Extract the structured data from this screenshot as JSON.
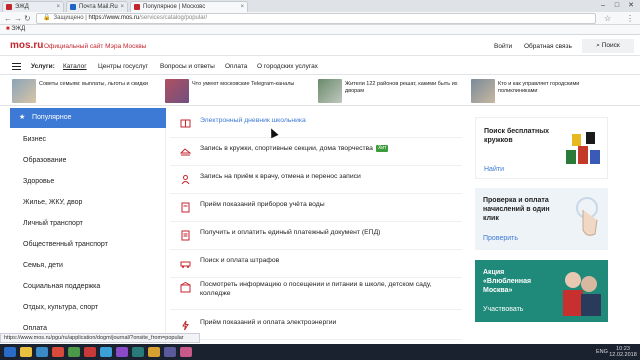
{
  "browser": {
    "tabs": [
      {
        "label": "ЭЖД"
      },
      {
        "label": "Почта Mail.Ru"
      },
      {
        "label": "Популярное | Московс"
      }
    ],
    "tab_close": "×",
    "security_label": "Защищено",
    "url_host": "https://www.mos.ru",
    "url_path": "/services/catalog/popular/",
    "bookmark": "ЭЖД",
    "status_url": "https://www.mos.ru/pgu/ru/application/dogm/journal/?onsite_from=popular"
  },
  "site": {
    "logo": "mos.ru",
    "tagline": "Официальный сайт Мэра Москвы",
    "login": "Войти",
    "feedback": "Обратная связь",
    "search": "Поиск"
  },
  "nav": {
    "label": "Услуги:",
    "items": [
      "Каталог",
      "Центры госуслуг",
      "Вопросы и ответы",
      "Оплата",
      "О городских услугах"
    ]
  },
  "news": [
    "Советы семьям: выплаты, льготы и скидки",
    "Что умеют московские Telegram-каналы",
    "Жители 122 районов решат, какими быть их дворам",
    "Кто и как управляет городскими поликлиниками"
  ],
  "menu": [
    "Популярное",
    "Бизнес",
    "Образование",
    "Здоровье",
    "Жилье, ЖКУ, двор",
    "Личный транспорт",
    "Общественный транспорт",
    "Семья, дети",
    "Социальная поддержка",
    "Отдых, культура, спорт",
    "Оплата"
  ],
  "services": [
    {
      "label": "Электронный дневник школьника"
    },
    {
      "label": "Запись в кружки, спортивные секции, дома творчества",
      "badge": "Хит"
    },
    {
      "label": "Запись на приём к врачу, отмена и перенос записи"
    },
    {
      "label": "Приём показаний приборов учёта воды"
    },
    {
      "label": "Получить и оплатить единый платежный документ (ЕПД)"
    },
    {
      "label": "Поиск и оплата штрафов"
    },
    {
      "label": "Посмотреть информацию о посещении и питании в школе, детском саду, колледже"
    },
    {
      "label": "Приём показаний и оплата электроэнергии"
    }
  ],
  "promos": [
    {
      "title": "Поиск бесплатных кружков",
      "link": "Найти"
    },
    {
      "title": "Проверка и оплата начислений в один клик",
      "link": "Проверить"
    },
    {
      "title": "Акция «Влюбленная Москва»",
      "link": "Участвовать"
    }
  ],
  "taskbar": {
    "lang": "ENG",
    "time": "10:23",
    "date": "12.02.2018"
  },
  "colors": {
    "brand_red": "#c4262e",
    "accent_blue": "#3d7ad6",
    "promo_teal": "#1f8a7a",
    "hit_green": "#3c9c3c"
  }
}
